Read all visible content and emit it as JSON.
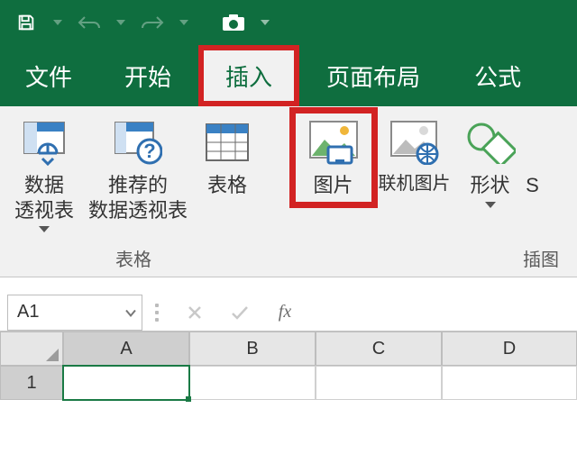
{
  "titlebar": {
    "save": "保存",
    "undo": "撤销",
    "redo": "重做",
    "camera": "屏幕截图"
  },
  "tabs": {
    "file": "文件",
    "home": "开始",
    "insert": "插入",
    "layout": "页面布局",
    "formulas": "公式"
  },
  "ribbon": {
    "pivot": "数据\n透视表",
    "recpivot": "推荐的\n数据透视表",
    "table": "表格",
    "picture": "图片",
    "onlinepic": "联机图片",
    "shapes": "形状",
    "moreLetter": "S",
    "group_tables": "表格",
    "group_illus": "插图"
  },
  "formula": {
    "namebox": "A1",
    "fx": "fx"
  },
  "columns": [
    "A",
    "B",
    "C",
    "D"
  ],
  "rows": [
    "1"
  ],
  "highlight": {
    "insert_tab": true,
    "picture_btn": true
  }
}
